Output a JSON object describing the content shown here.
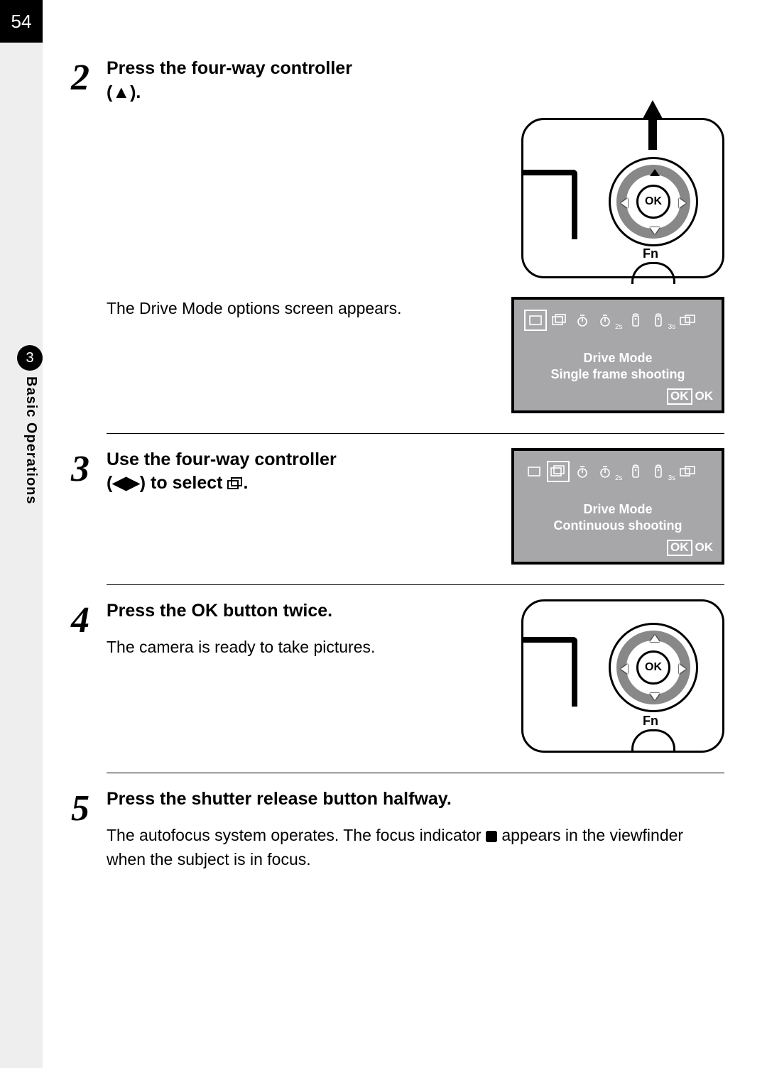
{
  "page_number": "54",
  "chapter": {
    "number": "3",
    "title": "Basic Operations"
  },
  "steps": {
    "s2": {
      "num": "2",
      "title_a": "Press the four-way controller",
      "title_b": "(▲).",
      "desc": "The Drive Mode options screen appears.",
      "ok": "OK",
      "fn": "Fn"
    },
    "s3": {
      "num": "3",
      "title_a": "Use the four-way controller",
      "title_b": "(◀▶) to select ",
      "title_icon": "continuous-shooting"
    },
    "s4": {
      "num": "4",
      "title_a": "Press the ",
      "title_ok": "OK",
      "title_b": " button twice.",
      "desc": "The camera is ready to take pictures.",
      "ok": "OK",
      "fn": "Fn"
    },
    "s5": {
      "num": "5",
      "title": "Press the shutter release button halfway.",
      "desc_a": "The autofocus system operates. The focus indicator ",
      "desc_b": " appears in the viewfinder when the subject is in focus."
    }
  },
  "lcd1": {
    "title": "Drive Mode",
    "subtitle": "Single frame shooting",
    "ok": "OK",
    "ok2": "OK",
    "selected_index": 0,
    "sub_2s": "2s",
    "sub_3s": "3s"
  },
  "lcd2": {
    "title": "Drive Mode",
    "subtitle": "Continuous shooting",
    "ok": "OK",
    "ok2": "OK",
    "selected_index": 1,
    "sub_2s": "2s",
    "sub_3s": "3s"
  }
}
